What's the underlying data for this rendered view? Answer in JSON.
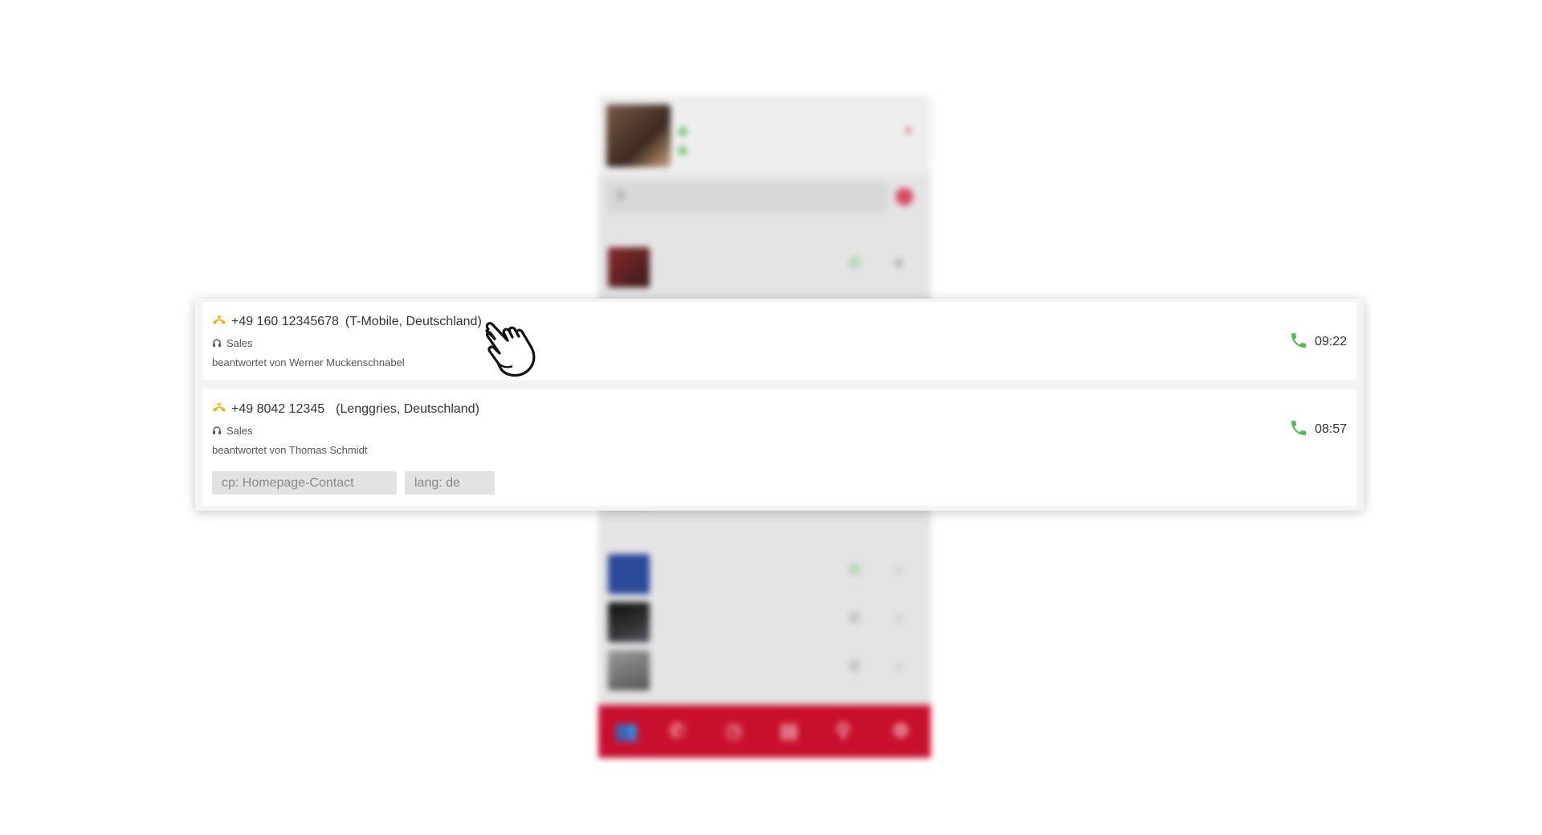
{
  "calls": [
    {
      "number": "+49 160 12345678",
      "location": "(T-Mobile, Deutschland)",
      "group": "Sales",
      "answered_by": "beantwortet von Werner Muckenschnabel",
      "time": "09:22",
      "tags": []
    },
    {
      "number": "+49 8042 12345",
      "location": "(Lenggries, Deutschland)",
      "group": "Sales",
      "answered_by": "beantwortet von Thomas Schmidt",
      "time": "08:57",
      "tags": [
        "cp: Homepage-Contact",
        "lang: de"
      ]
    }
  ],
  "colors": {
    "accent_red": "#c8102e",
    "call_green": "#4cbf4c",
    "incoming_icon": "#f0b400"
  },
  "icons": {
    "incoming_call": "incoming-call-icon",
    "group": "headset-icon",
    "call": "phone-icon",
    "cursor": "hand-cursor-icon"
  }
}
